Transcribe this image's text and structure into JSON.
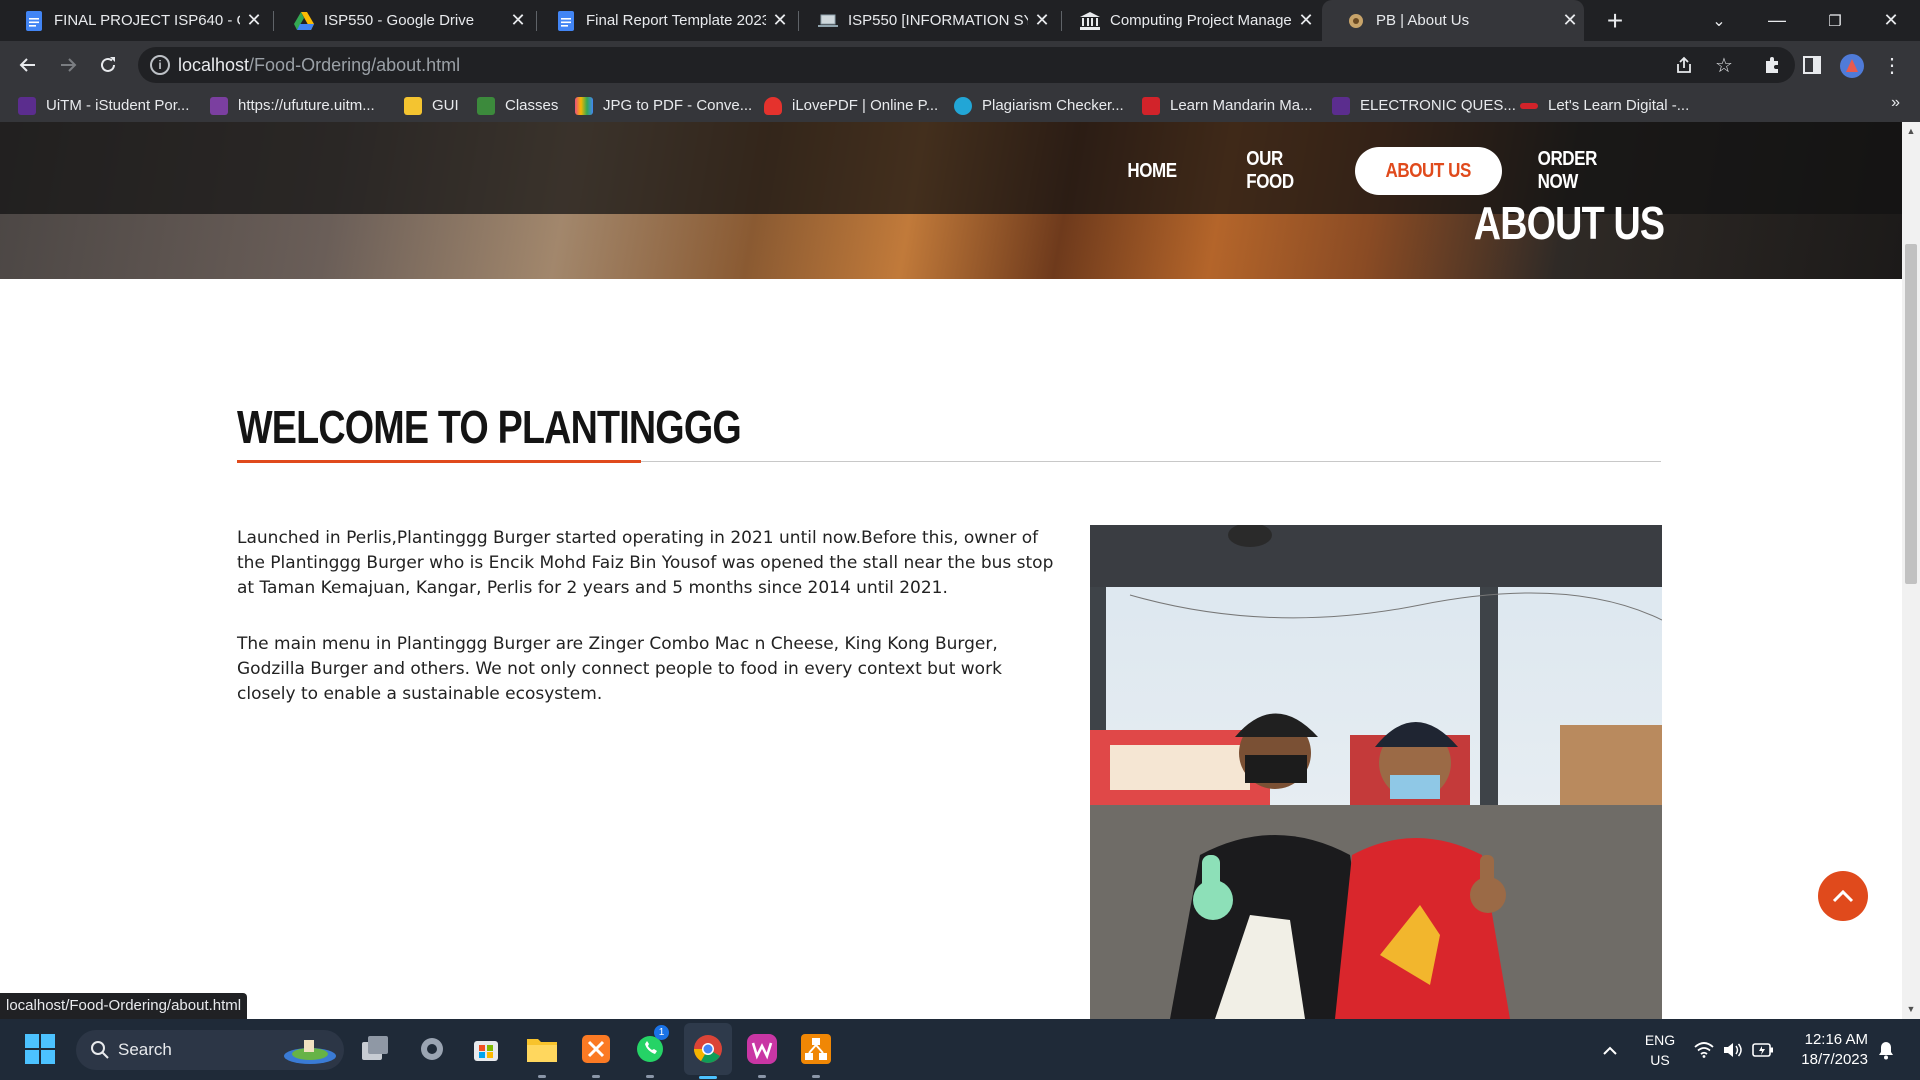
{
  "browser": {
    "tabs": [
      {
        "title": "FINAL PROJECT ISP640 - Go",
        "icon": "google-docs-icon"
      },
      {
        "title": "ISP550 - Google Drive",
        "icon": "google-drive-icon"
      },
      {
        "title": "Final Report Template 2023",
        "icon": "google-docs-icon"
      },
      {
        "title": "ISP550 [INFORMATION SYS",
        "icon": "laptop-icon"
      },
      {
        "title": "Computing Project Manage",
        "icon": "institution-icon"
      },
      {
        "title": "PB | About Us",
        "icon": "site-favicon"
      }
    ],
    "address": {
      "host": "localhost",
      "path": "/Food-Ordering/about.html"
    },
    "bookmarks": [
      {
        "label": "UiTM - iStudent Por...",
        "color": "#5b2d8e"
      },
      {
        "label": "https://ufuture.uitm...",
        "color": "#7b3fa0"
      },
      {
        "label": "GUI",
        "color": "#f4c430"
      },
      {
        "label": "Classes",
        "color": "#3c8a3c"
      },
      {
        "label": "JPG to PDF - Conve...",
        "color": "#e9507a"
      },
      {
        "label": "iLovePDF | Online P...",
        "color": "#e5322d"
      },
      {
        "label": "Plagiarism Checker...",
        "color": "#22a6d6"
      },
      {
        "label": "Learn Mandarin Ma...",
        "color": "#d2232a"
      },
      {
        "label": "ELECTRONIC QUES...",
        "color": "#5b2d8e"
      },
      {
        "label": "Let's Learn Digital -...",
        "color": "#d2232a"
      }
    ],
    "bookmarks_more": "»",
    "status_url": "localhost/Food-Ordering/about.html"
  },
  "site": {
    "nav": {
      "home": "HOME",
      "food": "OUR FOOD",
      "about": "ABOUT US",
      "order": "ORDER NOW"
    },
    "hero_title": "ABOUT US",
    "heading": "WELCOME TO PLANTINGGG",
    "paragraphs": [
      "Launched in Perlis,Plantinggg Burger started operating in 2021 until now.Before this, owner of the Plantinggg Burger who is Encik Mohd Faiz Bin Yousof was opened the stall near the bus stop at Taman Kemajuan, Kangar, Perlis for 2 years and 5 months since 2014 until 2021.",
      "The main menu in Plantinggg Burger are Zinger Combo Mac n Cheese, King Kong Burger, Godzilla Burger and others. We not only connect people to food in every context but work closely to enable a sustainable ecosystem."
    ],
    "accent_color": "#e04a1c"
  },
  "taskbar": {
    "search_label": "Search",
    "whatsapp_badge": "1",
    "language": {
      "line1": "ENG",
      "line2": "US"
    },
    "time": "12:16 AM",
    "date": "18/7/2023"
  }
}
